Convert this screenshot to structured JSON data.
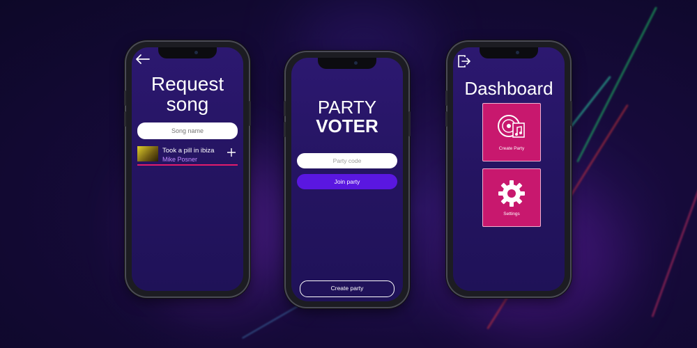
{
  "request_screen": {
    "title_line1": "Request",
    "title_line2": "song",
    "search_placeholder": "Song name",
    "song": {
      "title": "Took a pill in ibiza",
      "artist": "Mike Posner"
    }
  },
  "party_screen": {
    "title_line1": "PARTY",
    "title_line2": "VOTER",
    "code_placeholder": "Party code",
    "join_label": "Join party",
    "create_label": "Create party"
  },
  "dashboard_screen": {
    "title": "Dashboard",
    "tiles": [
      {
        "label": "Create Party",
        "icon": "vinyl-music-icon"
      },
      {
        "label": "Settings",
        "icon": "gear-icon"
      }
    ]
  },
  "colors": {
    "accent_pink": "#c8186e",
    "accent_purple": "#5a17e0",
    "underline_pink": "#e21c6c",
    "artist_text": "#c48cff"
  }
}
